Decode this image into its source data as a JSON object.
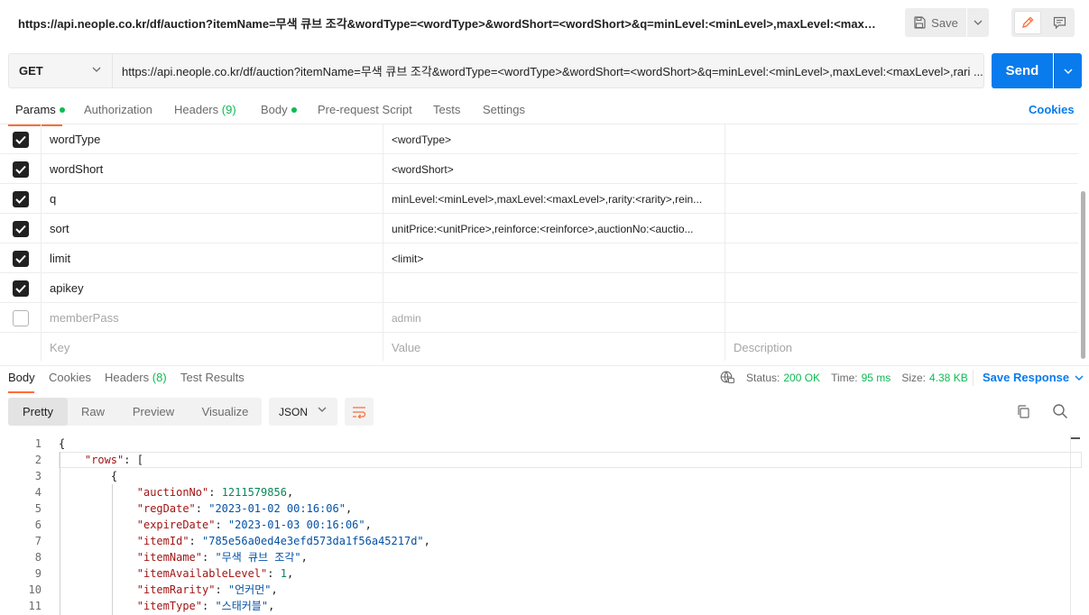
{
  "window": {
    "title": "https://api.neople.co.kr/df/auction?itemName=무색 큐브 조각&wordType=<wordType>&wordShort=<wordShort>&q=minLevel:<minLevel>,maxLevel:<maxLevel>,...",
    "save_label": "Save"
  },
  "request": {
    "method": "GET",
    "url": "https://api.neople.co.kr/df/auction?itemName=무색 큐브 조각&wordType=<wordType>&wordShort=<wordShort>&q=minLevel:<minLevel>,maxLevel:<maxLevel>,rari ...",
    "send_label": "Send"
  },
  "request_tabs": [
    {
      "label": "Params",
      "active": true,
      "dot": true
    },
    {
      "label": "Authorization"
    },
    {
      "label": "Headers",
      "count": "(9)"
    },
    {
      "label": "Body",
      "dot": true
    },
    {
      "label": "Pre-request Script"
    },
    {
      "label": "Tests"
    },
    {
      "label": "Settings"
    }
  ],
  "cookies_label": "Cookies",
  "params": [
    {
      "checked": true,
      "key": "wordType",
      "value": "<wordType>",
      "description": ""
    },
    {
      "checked": true,
      "key": "wordShort",
      "value": "<wordShort>",
      "description": ""
    },
    {
      "checked": true,
      "key": "q",
      "value": "minLevel:<minLevel>,maxLevel:<maxLevel>,rarity:<rarity>,rein...",
      "description": ""
    },
    {
      "checked": true,
      "key": "sort",
      "value": "unitPrice:<unitPrice>,reinforce:<reinforce>,auctionNo:<auctio...",
      "description": ""
    },
    {
      "checked": true,
      "key": "limit",
      "value": "<limit>",
      "description": ""
    },
    {
      "checked": true,
      "key": "apikey",
      "value": "",
      "description": ""
    },
    {
      "checked": false,
      "key": "memberPass",
      "value": "admin",
      "description": ""
    }
  ],
  "params_placeholder": {
    "key": "Key",
    "value": "Value",
    "description": "Description"
  },
  "response_tabs": [
    {
      "label": "Body",
      "active": true
    },
    {
      "label": "Cookies"
    },
    {
      "label": "Headers",
      "count": "(8)"
    },
    {
      "label": "Test Results"
    }
  ],
  "response_status": {
    "status_label": "Status:",
    "status_value": "200 OK",
    "time_label": "Time:",
    "time_value": "95 ms",
    "size_label": "Size:",
    "size_value": "4.38 KB",
    "save_response_label": "Save Response"
  },
  "view_modes": [
    "Pretty",
    "Raw",
    "Preview",
    "Visualize"
  ],
  "format": "JSON",
  "code_lines": [
    {
      "n": "1",
      "text": "{"
    },
    {
      "n": "2",
      "key": "\"rows\"",
      "rest": ": ["
    },
    {
      "n": "3",
      "text": "{"
    },
    {
      "n": "4",
      "key": "\"auctionNo\"",
      "num": "1211579856",
      "end": ","
    },
    {
      "n": "5",
      "key": "\"regDate\"",
      "str": "\"2023-01-02 00:16:06\"",
      "end": ","
    },
    {
      "n": "6",
      "key": "\"expireDate\"",
      "str": "\"2023-01-03 00:16:06\"",
      "end": ","
    },
    {
      "n": "7",
      "key": "\"itemId\"",
      "str": "\"785e56a0ed4e3efd573da1f56a45217d\"",
      "end": ","
    },
    {
      "n": "8",
      "key": "\"itemName\"",
      "str": "\"무색 큐브 조각\"",
      "end": ","
    },
    {
      "n": "9",
      "key": "\"itemAvailableLevel\"",
      "num": "1",
      "end": ","
    },
    {
      "n": "10",
      "key": "\"itemRarity\"",
      "str": "\"언커먼\"",
      "end": ","
    },
    {
      "n": "11",
      "key": "\"itemType\"",
      "str": "\"스태커블\"",
      "end": ","
    }
  ],
  "colors": {
    "accent_orange": "#ff6c37",
    "send_blue": "#097bed",
    "status_green": "#0cbb52"
  }
}
